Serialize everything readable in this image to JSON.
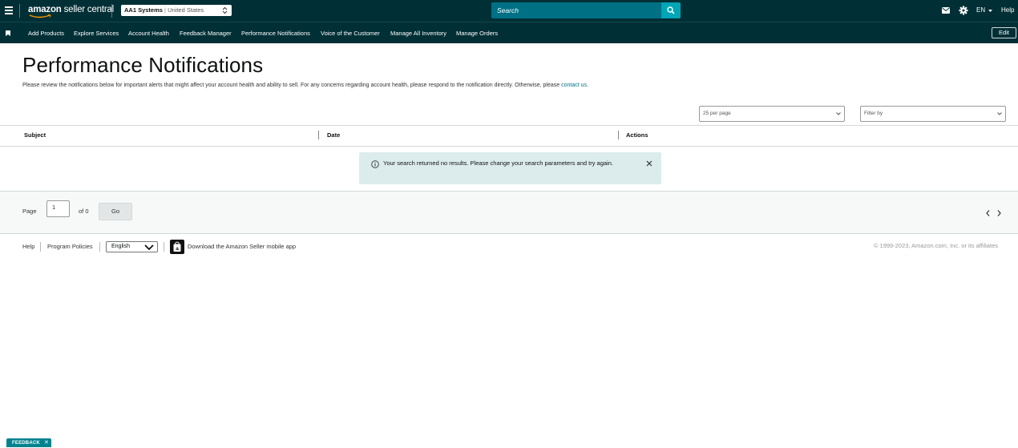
{
  "topbar": {
    "logo_bold": "amazon",
    "logo_rest": " seller central",
    "account_name": "AA1 Systems",
    "account_sep": "|",
    "account_region": "United States",
    "search_placeholder": "Search",
    "lang": "EN",
    "help": "Help"
  },
  "nav": {
    "items": [
      "Add Products",
      "Explore Services",
      "Account Health",
      "Feedback Manager",
      "Performance Notifications",
      "Voice of the Customer",
      "Manage All Inventory",
      "Manage Orders"
    ],
    "edit": "Edit"
  },
  "page": {
    "title": "Performance Notifications",
    "desc": "Please review the notifications below for important alerts that might affect your account health and ability to sell. For any concerns regarding account health, please respond to the notification directly. Otherwise, please ",
    "desc_link": "contact us",
    "desc_end": "."
  },
  "filters": {
    "per_page": "25 per page",
    "filter_by": "Filter by"
  },
  "table": {
    "columns": [
      "Subject",
      "Date",
      "Actions"
    ]
  },
  "alert": {
    "message": "Your search returned no results. Please change your search parameters and try again."
  },
  "pager": {
    "label": "Page",
    "current": "1",
    "of": "of 0",
    "go": "Go"
  },
  "footer": {
    "help": "Help",
    "program_policies": "Program Policies",
    "language": "English",
    "app_text": "Download the Amazon Seller mobile app",
    "copyright": "© 1999-2023, Amazon.com, Inc. or its affiliates"
  },
  "feedback": {
    "label": "FEEDBACK",
    "close": "✕"
  },
  "colors": {
    "header_bg": "#002f36",
    "search_bg": "#007185",
    "search_button": "#00a5b6",
    "alert_bg": "#dcecec",
    "link": "#007185",
    "feedback_bg": "#00838f"
  }
}
